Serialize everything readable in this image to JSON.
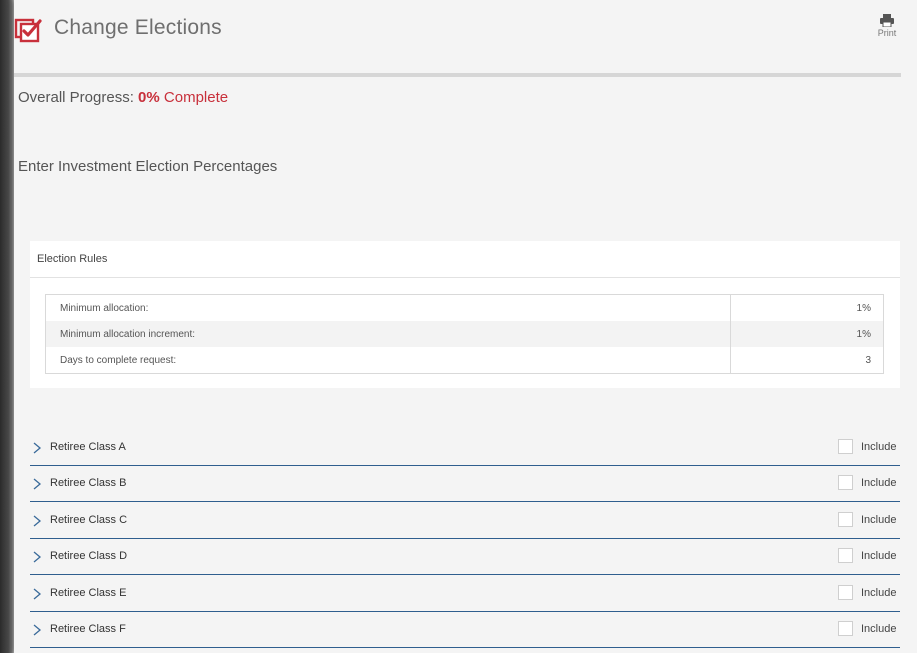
{
  "header": {
    "title": "Change Elections",
    "print_label": "Print"
  },
  "progress": {
    "label": "Overall Progress:",
    "value": "0%",
    "suffix": "Complete"
  },
  "section_heading": "Enter Investment Election Percentages",
  "election_rules": {
    "title": "Election Rules",
    "rows": [
      {
        "label": "Minimum allocation:",
        "value": "1%"
      },
      {
        "label": "Minimum allocation increment:",
        "value": "1%"
      },
      {
        "label": "Days to complete request:",
        "value": "3"
      }
    ]
  },
  "classes": [
    {
      "label": "Retiree Class A",
      "include_label": "Include",
      "included": false
    },
    {
      "label": "Retiree Class B",
      "include_label": "Include",
      "included": false
    },
    {
      "label": "Retiree Class C",
      "include_label": "Include",
      "included": false
    },
    {
      "label": "Retiree Class D",
      "include_label": "Include",
      "included": false
    },
    {
      "label": "Retiree Class E",
      "include_label": "Include",
      "included": false
    },
    {
      "label": "Retiree Class F",
      "include_label": "Include",
      "included": false
    }
  ],
  "colors": {
    "accent": "#c8303b",
    "row_border": "#2f5e8e",
    "background": "#f4f4f4"
  },
  "icons": {
    "title": "checkbox-checked-icon",
    "print": "printer-icon",
    "expand": "chevron-right-icon"
  }
}
